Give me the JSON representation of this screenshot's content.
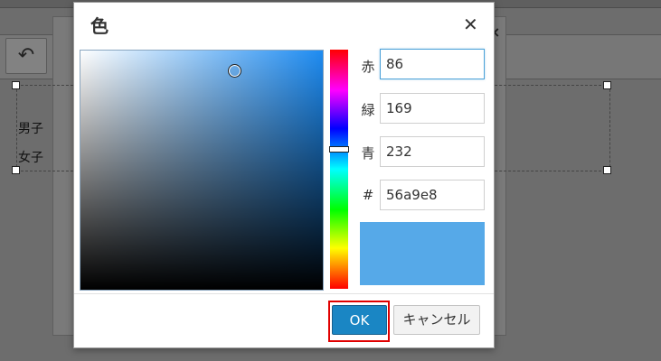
{
  "background": {
    "undo_icon": "undo-icon",
    "row1_text": "男子",
    "row2_text": "女子"
  },
  "dialog": {
    "title": "色",
    "close_icon": "close-icon",
    "color_field": {
      "cursor_icon": "color-picker-cursor-icon"
    },
    "hue_slider": {
      "marker_icon": "hue-marker-icon"
    },
    "channels": {
      "red": {
        "label": "赤",
        "value": "86"
      },
      "green": {
        "label": "緑",
        "value": "169"
      },
      "blue": {
        "label": "青",
        "value": "232"
      },
      "hex": {
        "label": "#",
        "value": "56a9e8"
      }
    },
    "preview_color": "#56a9e8",
    "ok_label": "OK",
    "cancel_label": "キャンセル"
  }
}
